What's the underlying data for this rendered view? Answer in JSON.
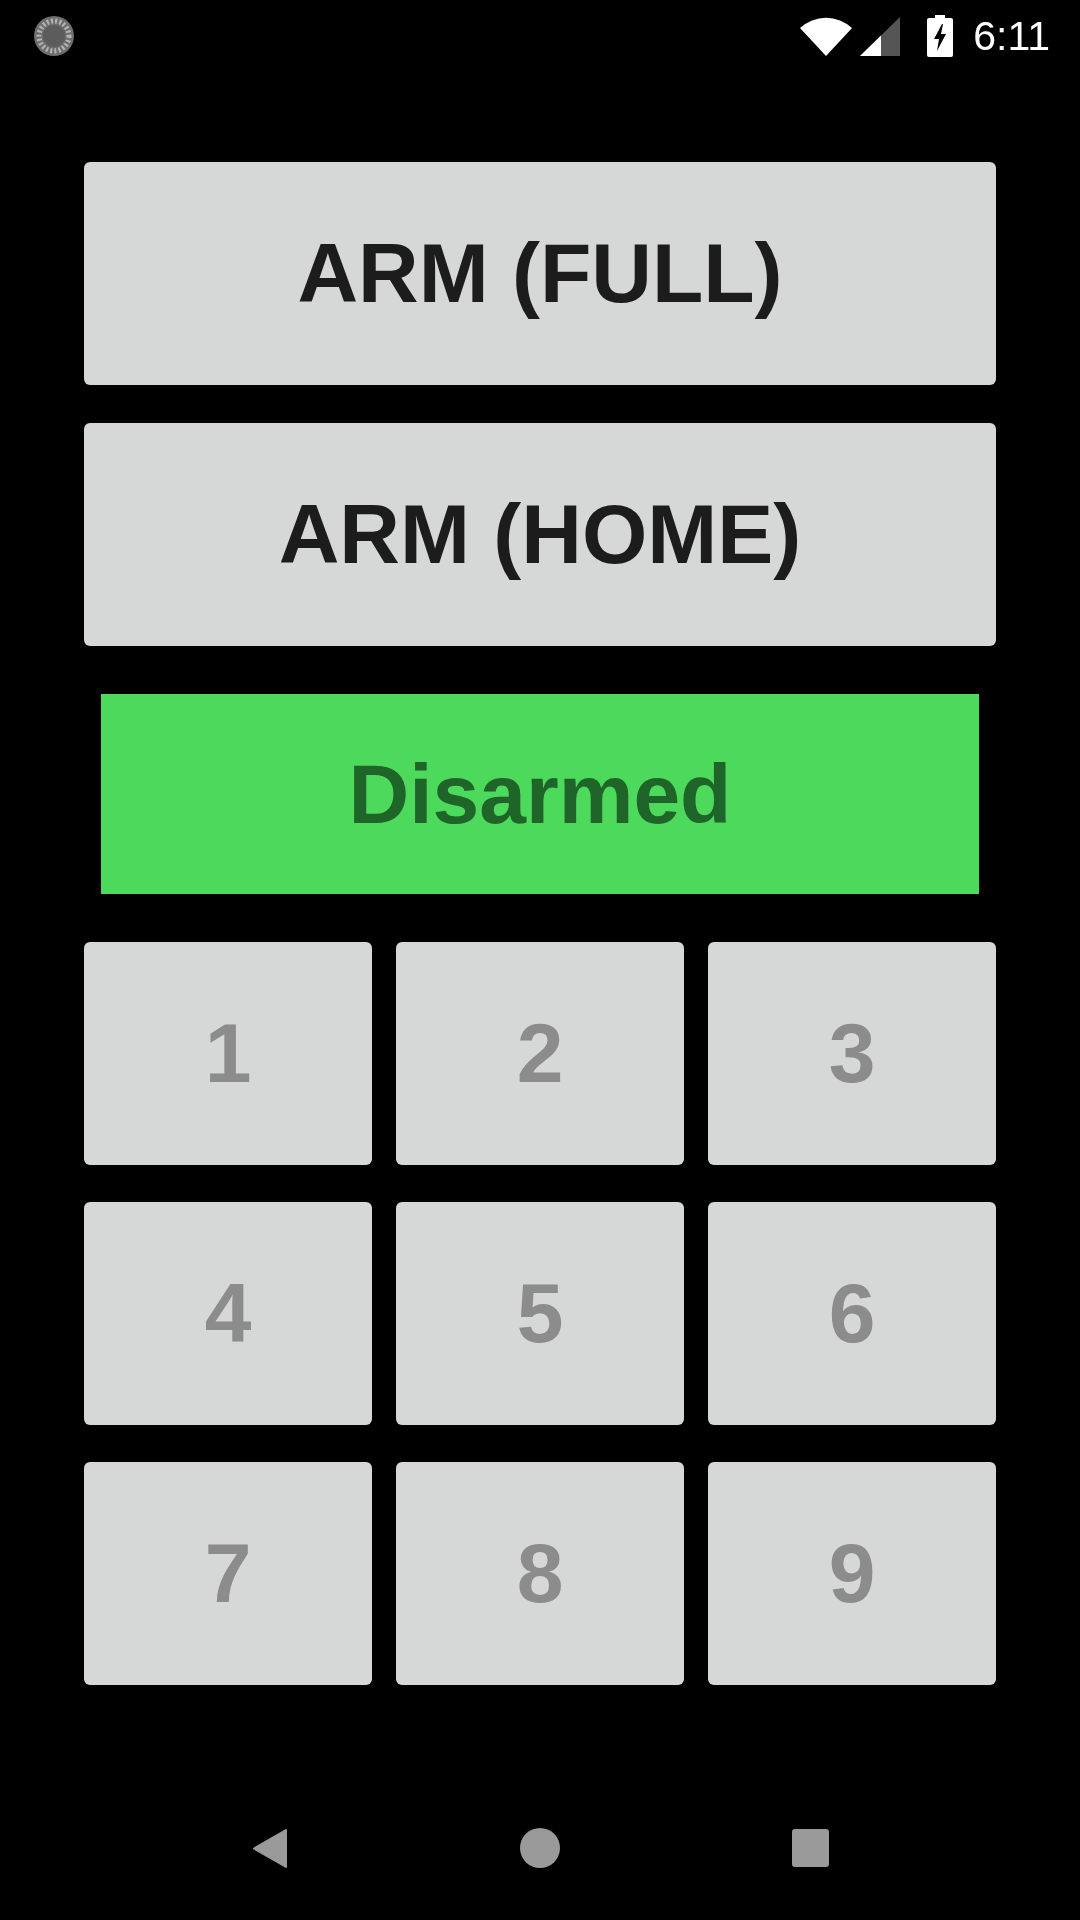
{
  "status_bar": {
    "time": "6:11"
  },
  "arm_buttons": [
    {
      "label": "ARM (FULL)"
    },
    {
      "label": "ARM (HOME)"
    }
  ],
  "status_banner": {
    "label": "Disarmed",
    "armed": false
  },
  "keypad": [
    {
      "label": "1",
      "disabled": true
    },
    {
      "label": "2",
      "disabled": true
    },
    {
      "label": "3",
      "disabled": true
    },
    {
      "label": "4",
      "disabled": true
    },
    {
      "label": "5",
      "disabled": true
    },
    {
      "label": "6",
      "disabled": true
    },
    {
      "label": "7",
      "disabled": true
    },
    {
      "label": "8",
      "disabled": true
    },
    {
      "label": "9",
      "disabled": true
    }
  ]
}
